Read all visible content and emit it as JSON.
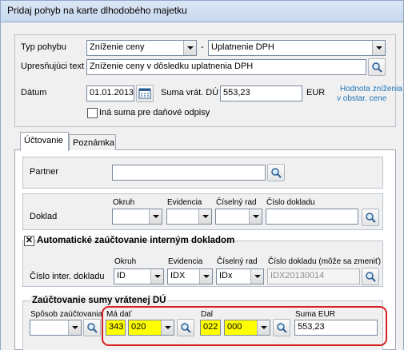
{
  "window": {
    "title": "Pridaj pohyb na karte dlhodobého majetku"
  },
  "header": {
    "typ_pohybu_label": "Typ pohybu",
    "typ_pohybu_value": "Zníženie ceny",
    "separator": "-",
    "subtype_value": "Uplatnenie DPH",
    "upresnujuci_label": "Upresňujúci text",
    "upresnujuci_value": "Zníženie ceny v dôsledku uplatnenia DPH",
    "datum_label": "Dátum",
    "datum_value": "01.01.2013",
    "suma_label": "Suma vrát. DÚ",
    "suma_value": "553,23",
    "currency": "EUR",
    "link_line1": "Hodnota zníženia",
    "link_line2": "v obstar. cene",
    "checkbox_label": "Iná suma pre daňové odpisy"
  },
  "tabs": [
    {
      "label": "Účtovanie"
    },
    {
      "label": "Poznámka"
    }
  ],
  "partner": {
    "label": "Partner",
    "value": ""
  },
  "doklad": {
    "label": "Doklad",
    "okruh": "Okruh",
    "evidencia": "Evidencia",
    "ciselny_rad": "Číselný rad",
    "cislo_dokladu": "Číslo dokladu"
  },
  "auto": {
    "checkbox_mark": "✕",
    "label": "Automatické zaúčtovanie interným dokladom",
    "row_label": "Číslo inter. dokladu",
    "okruh_label": "Okruh",
    "okruh_value": "ID",
    "evidencia_label": "Evidencia",
    "evidencia_value": "IDX",
    "rad_label": "Číselný rad",
    "rad_value": "IDx",
    "cislo_label": "Číslo dokladu (môže sa zmeniť)",
    "cislo_value": "IDX20130014"
  },
  "suma": {
    "title": "Zaúčtovanie sumy vrátenej DÚ",
    "sposob_label": "Spôsob zaúčtovania",
    "ma_dat_label": "Má dať",
    "ma_dat_syn": "343",
    "ma_dat_an": "020",
    "dal_label": "Dal",
    "dal_syn": "022",
    "dal_an": "000",
    "suma_eur_label": "Suma EUR",
    "suma_eur_value": "553,23"
  },
  "colors": {
    "highlight_fill": "#ffff00",
    "outline": "#d92020",
    "link": "#1e74b8"
  },
  "icons": [
    "search-icon",
    "calendar-icon",
    "chevron-down-icon"
  ]
}
